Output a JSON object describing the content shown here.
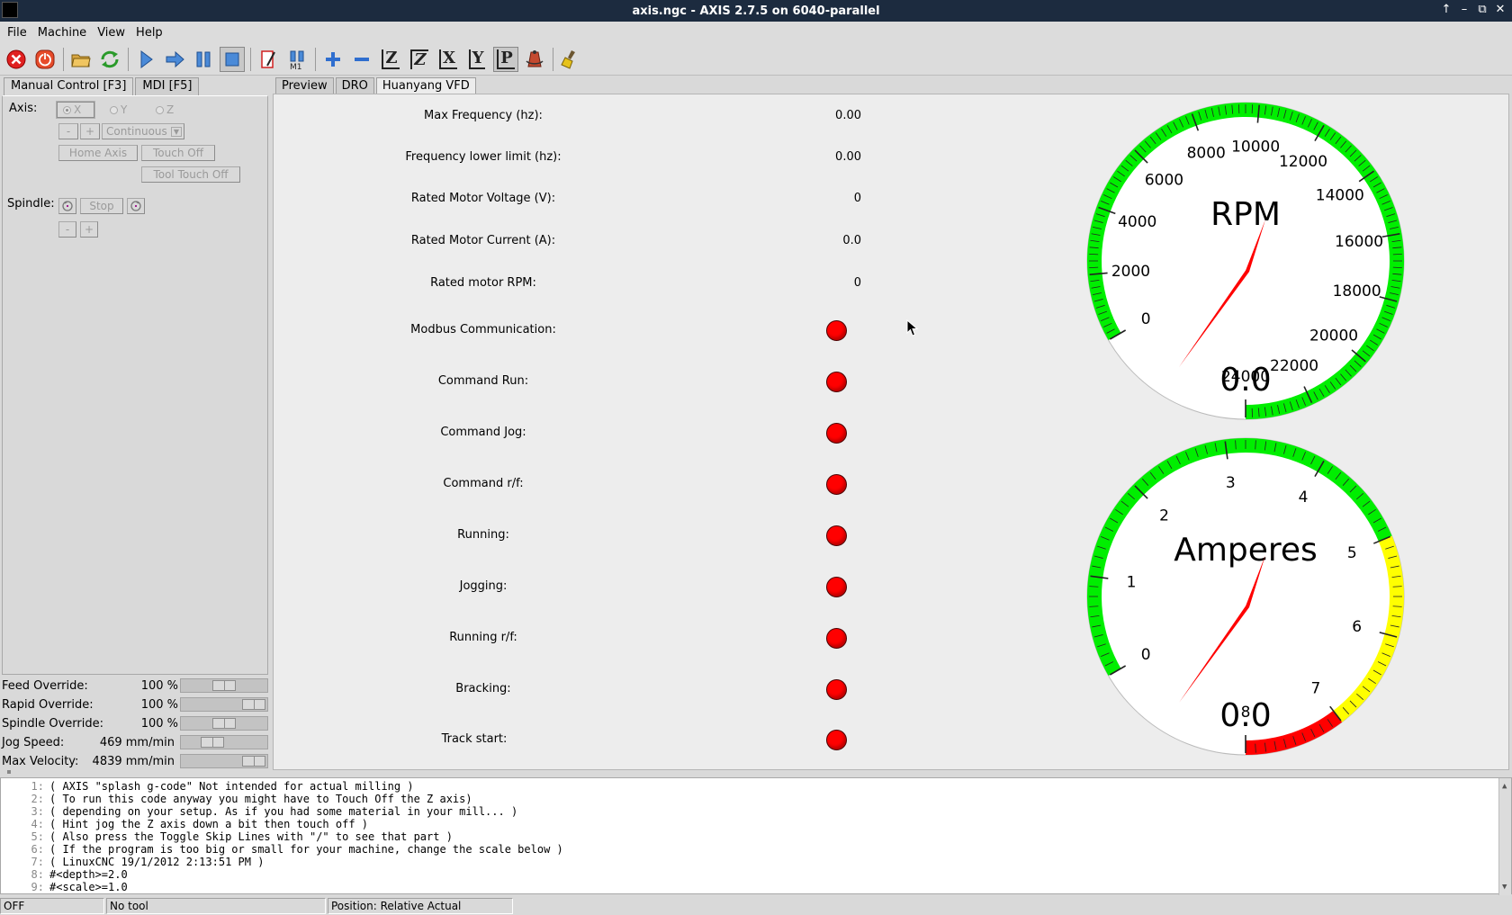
{
  "window": {
    "title": "axis.ngc - AXIS 2.7.5 on 6040-parallel",
    "controls": [
      "↑",
      "–",
      "⧉",
      "✕"
    ]
  },
  "menu": [
    "File",
    "Machine",
    "View",
    "Help"
  ],
  "left_tabs": [
    "Manual Control [F3]",
    "MDI [F5]"
  ],
  "manual": {
    "axis_label": "Axis:",
    "axes": [
      "X",
      "Y",
      "Z"
    ],
    "minus": "-",
    "plus": "+",
    "jog_mode": "Continuous",
    "home_axis": "Home Axis",
    "touch_off": "Touch Off",
    "tool_touch_off": "Tool Touch Off",
    "spindle_label": "Spindle:",
    "spindle_stop": "Stop"
  },
  "overrides": [
    {
      "label": "Feed Override:",
      "value": "100 %",
      "level": 0.5
    },
    {
      "label": "Rapid Override:",
      "value": "100 %",
      "level": 1.0
    },
    {
      "label": "Spindle Override:",
      "value": "100 %",
      "level": 0.5
    },
    {
      "label": "Jog Speed:",
      "value": "469 mm/min",
      "level": 0.3
    },
    {
      "label": "Max Velocity:",
      "value": "4839 mm/min",
      "level": 1.0
    }
  ],
  "right_tabs": [
    "Preview",
    "DRO",
    "Huanyang VFD"
  ],
  "vfd": {
    "params": [
      {
        "label": "Max Frequency (hz):",
        "value": "0.00"
      },
      {
        "label": "Frequency lower limit (hz):",
        "value": "0.00"
      },
      {
        "label": "Rated Motor Voltage (V):",
        "value": "0"
      },
      {
        "label": "Rated Motor Current (A):",
        "value": "0.0"
      },
      {
        "label": "Rated motor RPM:",
        "value": "0"
      }
    ],
    "indicators": [
      {
        "label": "Modbus Communication:",
        "state": "off",
        "color": "#ff0000"
      },
      {
        "label": "Command Run:",
        "state": "off",
        "color": "#ff0000"
      },
      {
        "label": "Command Jog:",
        "state": "off",
        "color": "#ff0000"
      },
      {
        "label": "Command r/f:",
        "state": "off",
        "color": "#ff0000"
      },
      {
        "label": "Running:",
        "state": "off",
        "color": "#ff0000"
      },
      {
        "label": "Jogging:",
        "state": "off",
        "color": "#ff0000"
      },
      {
        "label": "Running r/f:",
        "state": "off",
        "color": "#ff0000"
      },
      {
        "label": "Bracking:",
        "state": "off",
        "color": "#ff0000"
      },
      {
        "label": "Track start:",
        "state": "off",
        "color": "#ff0000"
      }
    ]
  },
  "gauges": {
    "rpm": {
      "title": "RPM",
      "readout": "0.0",
      "min": 0,
      "max": 24000,
      "labels": [
        "0",
        "2000",
        "4000",
        "6000",
        "8000",
        "10000",
        "12000",
        "14000",
        "16000",
        "18000",
        "20000",
        "22000",
        "24000"
      ],
      "value": 0,
      "zones": [
        {
          "from": 0,
          "to": 24000,
          "color": "#00ee00"
        }
      ]
    },
    "amps": {
      "title": "Amperes",
      "readout": "0.0",
      "min": 0,
      "max": 8,
      "labels": [
        "0",
        "1",
        "2",
        "3",
        "4",
        "5",
        "6",
        "7",
        "8"
      ],
      "value": 0,
      "zones": [
        {
          "from": 0,
          "to": 5,
          "color": "#00ee00"
        },
        {
          "from": 5,
          "to": 7,
          "color": "#ffff00"
        },
        {
          "from": 7,
          "to": 8,
          "color": "#ff0000"
        }
      ]
    }
  },
  "gcode": [
    {
      "n": "1:",
      "text": "( AXIS \"splash g-code\" Not intended for actual milling )"
    },
    {
      "n": "2:",
      "text": "( To run this code anyway you might have to Touch Off the Z axis)"
    },
    {
      "n": "3:",
      "text": "( depending on your setup. As if you had some material in your mill... )"
    },
    {
      "n": "4:",
      "text": "( Hint jog the Z axis down a bit then touch off )"
    },
    {
      "n": "5:",
      "text": "( Also press the Toggle Skip Lines with \"/\" to see that part )"
    },
    {
      "n": "6:",
      "text": "( If the program is too big or small for your machine, change the scale below )"
    },
    {
      "n": "7:",
      "text": "( LinuxCNC 19/1/2012 2:13:51 PM )"
    },
    {
      "n": "8:",
      "text": "#<depth>=2.0"
    },
    {
      "n": "9:",
      "text": "#<scale>=1.0"
    }
  ],
  "status": {
    "state": "OFF",
    "tool": "No tool",
    "position": "Position: Relative Actual"
  },
  "toolbar": {
    "icons": [
      "estop-icon",
      "power-icon",
      "open-file-icon",
      "reload-icon",
      "run-icon",
      "step-icon",
      "pause-icon",
      "stop-icon",
      "skip-lines-icon",
      "optional-stop-icon",
      "zoom-in-icon",
      "zoom-out-icon",
      "view-z-icon",
      "view-z2-icon",
      "view-x-icon",
      "view-y-icon",
      "view-p-icon",
      "rotate-icon",
      "clear-plot-icon"
    ],
    "letters": {
      "z": "Z",
      "x": "X",
      "y": "Y",
      "p": "P",
      "m1": "M1"
    }
  },
  "colors": {
    "led_off": "#ff0000",
    "needle": "#ff0000",
    "gauge_green": "#00ee00"
  }
}
